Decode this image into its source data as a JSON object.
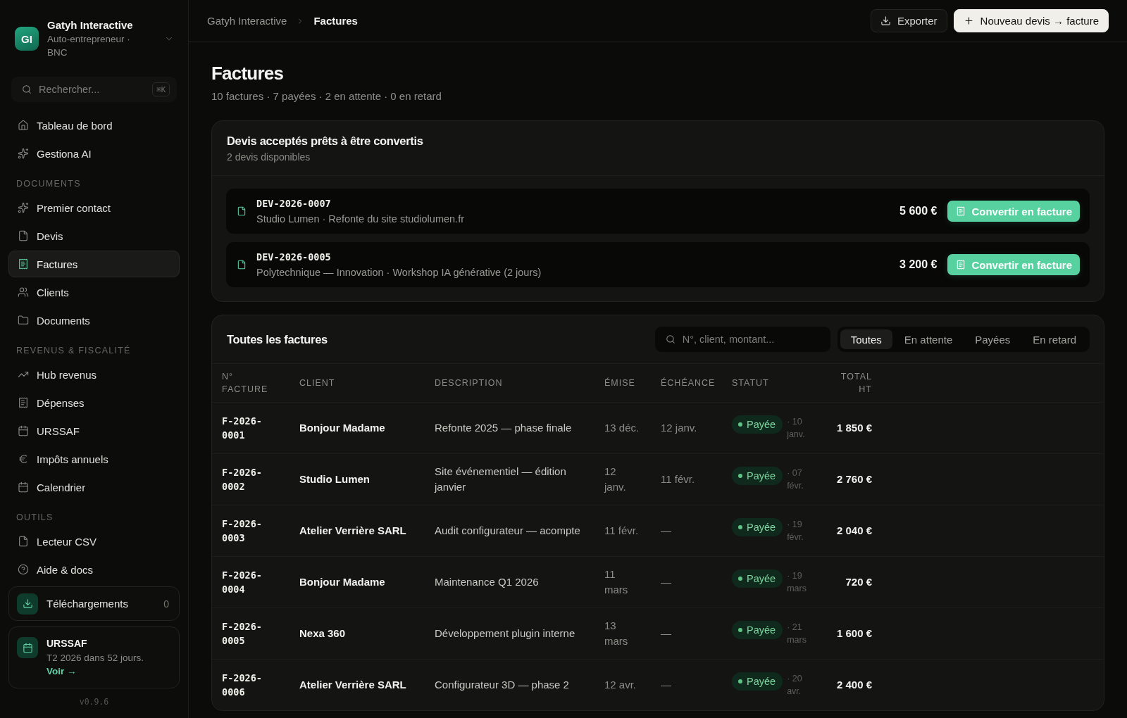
{
  "sidebar": {
    "workspace": {
      "initials": "GI",
      "name": "Gatyh Interactive",
      "plan": "Auto-entrepreneur · BNC"
    },
    "search": {
      "placeholder": "Rechercher...",
      "shortcut": "⌘K"
    },
    "nav": [
      {
        "items": [
          {
            "label": "Tableau de bord",
            "selected": false
          },
          {
            "label": "Gestiona AI",
            "selected": false
          }
        ]
      },
      {
        "heading": "DOCUMENTS",
        "items": [
          {
            "label": "Premier contact",
            "selected": false
          },
          {
            "label": "Devis",
            "selected": false
          },
          {
            "label": "Factures",
            "selected": true
          },
          {
            "label": "Clients",
            "selected": false
          },
          {
            "label": "Documents",
            "selected": false
          }
        ]
      },
      {
        "heading": "REVENUS & FISCALITÉ",
        "items": [
          {
            "label": "Hub revenus",
            "selected": false
          },
          {
            "label": "Dépenses",
            "selected": false
          },
          {
            "label": "URSSAF",
            "selected": false
          },
          {
            "label": "Impôts annuels",
            "selected": false
          },
          {
            "label": "Calendrier",
            "selected": false
          }
        ]
      },
      {
        "heading": "OUTILS",
        "items": [
          {
            "label": "Lecteur CSV",
            "selected": false
          },
          {
            "label": "Aide & docs",
            "selected": false
          }
        ]
      }
    ],
    "downloads": {
      "label": "Téléchargements",
      "count": "0"
    },
    "reminder": {
      "title": "URSSAF",
      "text": "T2 2026 dans 52 jours.",
      "link": "Voir →"
    },
    "version": "v0.9.6"
  },
  "topbar": {
    "breadcrumb": [
      {
        "label": "Gatyh Interactive",
        "current": false
      },
      {
        "label": "Factures",
        "current": true
      }
    ],
    "buttons": [
      {
        "label": "Exporter",
        "kind": "secondary"
      },
      {
        "label": "Nouveau devis → facture",
        "kind": "primary"
      }
    ]
  },
  "page": {
    "title": "Factures",
    "summary": "10 factures · 7 payées · 2 en attente · 0 en retard"
  },
  "quotes": {
    "title": "Devis acceptés prêts à être convertis",
    "subtitle": "2 devis disponibles",
    "items": [
      {
        "number": "DEV-2026-0007",
        "description": "Studio Lumen · Refonte du site studiolumen.fr",
        "amount": "5 600 €",
        "action": "Convertir en facture"
      },
      {
        "number": "DEV-2026-0005",
        "description": "Polytechnique — Innovation · Workshop IA générative (2 jours)",
        "amount": "3 200 €",
        "action": "Convertir en facture"
      }
    ]
  },
  "invoices": {
    "title": "Toutes les factures",
    "search": {
      "placeholder": "N°, client, montant..."
    },
    "filters": [
      {
        "label": "Toutes",
        "selected": true
      },
      {
        "label": "En attente",
        "selected": false
      },
      {
        "label": "Payées",
        "selected": false
      },
      {
        "label": "En retard",
        "selected": false
      }
    ],
    "columns": [
      "N° FACTURE",
      "CLIENT",
      "DESCRIPTION",
      "ÉMISE",
      "ÉCHÉANCE",
      "STATUT",
      "TOTAL HT"
    ],
    "rows": [
      {
        "number": "F-2026-0001",
        "client": "Bonjour Madame",
        "description": "Refonte 2025 — phase finale",
        "issued": "13 déc.",
        "due": "12 janv.",
        "status": {
          "kind": "paid",
          "label": "Payée",
          "date": "· 10 janv."
        },
        "total": "1 850 €"
      },
      {
        "number": "F-2026-0002",
        "client": "Studio Lumen",
        "description": "Site événementiel — édition janvier",
        "issued": "12 janv.",
        "due": "11 févr.",
        "status": {
          "kind": "paid",
          "label": "Payée",
          "date": "· 07 févr."
        },
        "total": "2 760 €"
      },
      {
        "number": "F-2026-0003",
        "client": "Atelier Verrière SARL",
        "description": "Audit configurateur — acompte",
        "issued": "11 févr.",
        "due": "—",
        "status": {
          "kind": "paid",
          "label": "Payée",
          "date": "· 19 févr."
        },
        "total": "2 040 €"
      },
      {
        "number": "F-2026-0004",
        "client": "Bonjour Madame",
        "description": "Maintenance Q1 2026",
        "issued": "11 mars",
        "due": "—",
        "status": {
          "kind": "paid",
          "label": "Payée",
          "date": "· 19 mars"
        },
        "total": "720 €"
      },
      {
        "number": "F-2026-0005",
        "client": "Nexa 360",
        "description": "Développement plugin interne",
        "issued": "13 mars",
        "due": "—",
        "status": {
          "kind": "paid",
          "label": "Payée",
          "date": "· 21 mars"
        },
        "total": "1 600 €"
      },
      {
        "number": "F-2026-0006",
        "client": "Atelier Verrière SARL",
        "description": "Configurateur 3D — phase 2",
        "issued": "12 avr.",
        "due": "—",
        "status": {
          "kind": "paid",
          "label": "Payée",
          "date": "· 20 avr."
        },
        "total": "2 400 €"
      }
    ]
  }
}
